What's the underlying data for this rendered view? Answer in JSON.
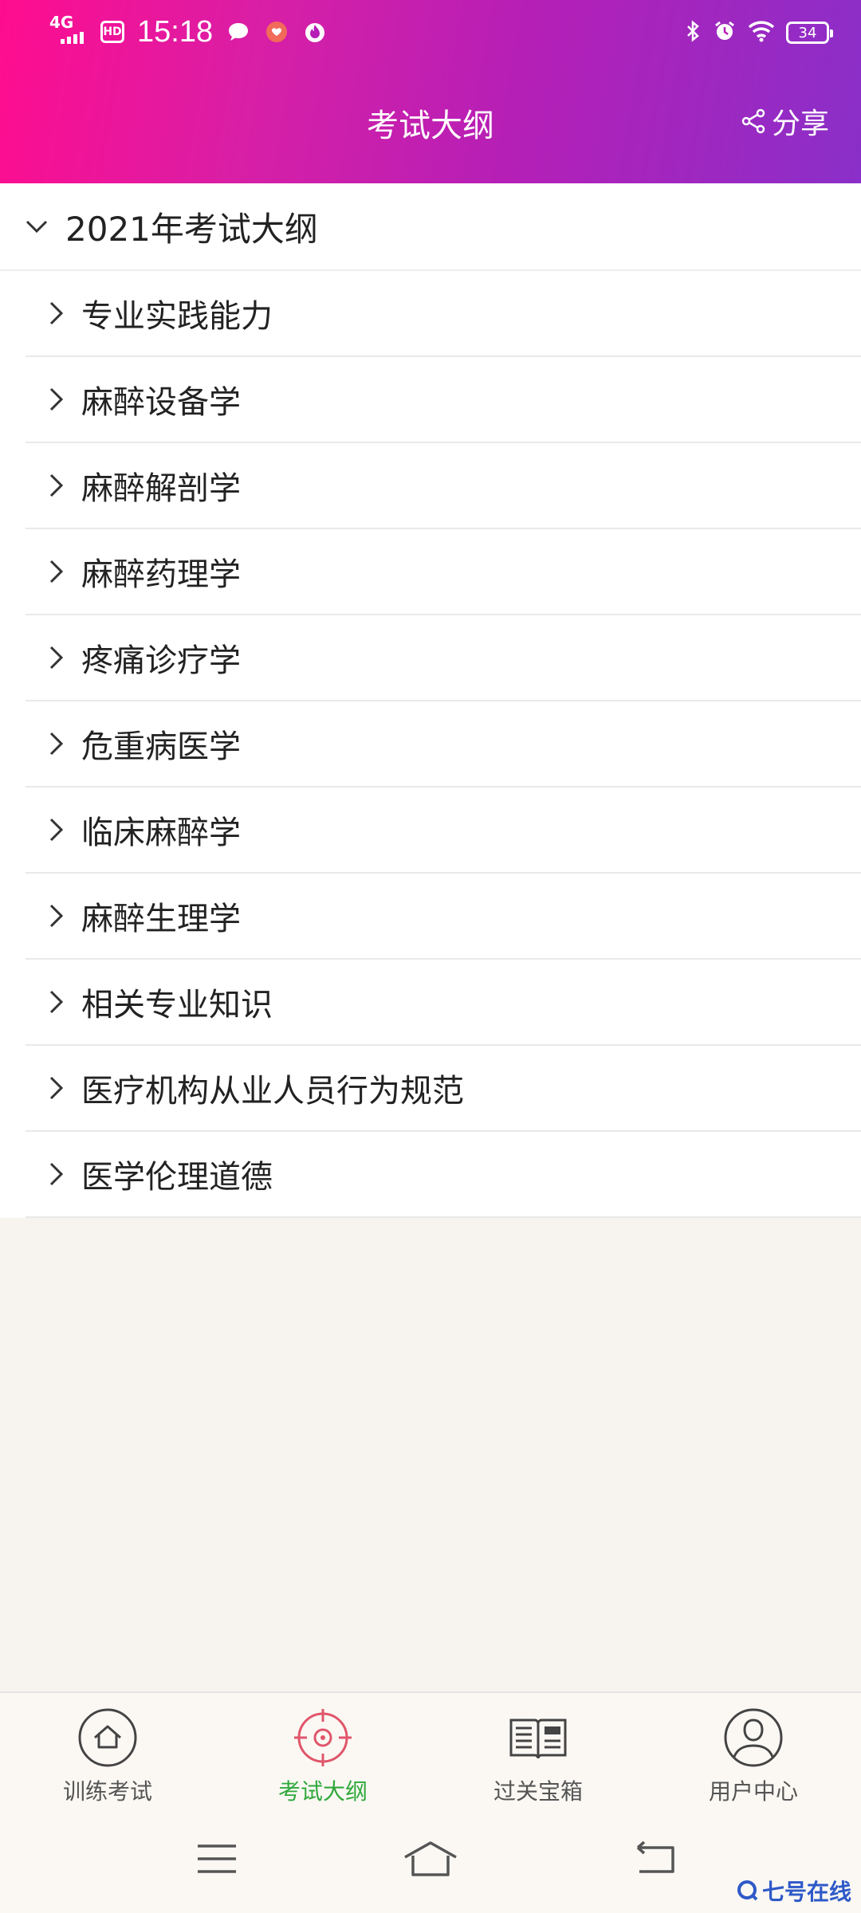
{
  "status_bar": {
    "network": "4G",
    "hd": "HD",
    "time": "15:18",
    "battery": "34"
  },
  "header": {
    "title": "考试大纲",
    "share_label": "分享"
  },
  "outline": {
    "group_title": "2021年考试大纲",
    "items": [
      {
        "label": "专业实践能力"
      },
      {
        "label": "麻醉设备学"
      },
      {
        "label": "麻醉解剖学"
      },
      {
        "label": "麻醉药理学"
      },
      {
        "label": "疼痛诊疗学"
      },
      {
        "label": "危重病医学"
      },
      {
        "label": "临床麻醉学"
      },
      {
        "label": "麻醉生理学"
      },
      {
        "label": "相关专业知识"
      },
      {
        "label": "医疗机构从业人员行为规范"
      },
      {
        "label": "医学伦理道德"
      }
    ]
  },
  "bottom_nav": {
    "tabs": [
      {
        "label": "训练考试",
        "icon": "home-icon"
      },
      {
        "label": "考试大纲",
        "icon": "target-icon",
        "active": true
      },
      {
        "label": "过关宝箱",
        "icon": "news-book-icon"
      },
      {
        "label": "用户中心",
        "icon": "user-icon"
      }
    ]
  },
  "watermark": "七号在线",
  "colors": {
    "header_gradient_start": "#ff0c8f",
    "header_gradient_end": "#8a2fc9",
    "active_tab": "#2fa83a",
    "target_icon": "#e0566a"
  }
}
